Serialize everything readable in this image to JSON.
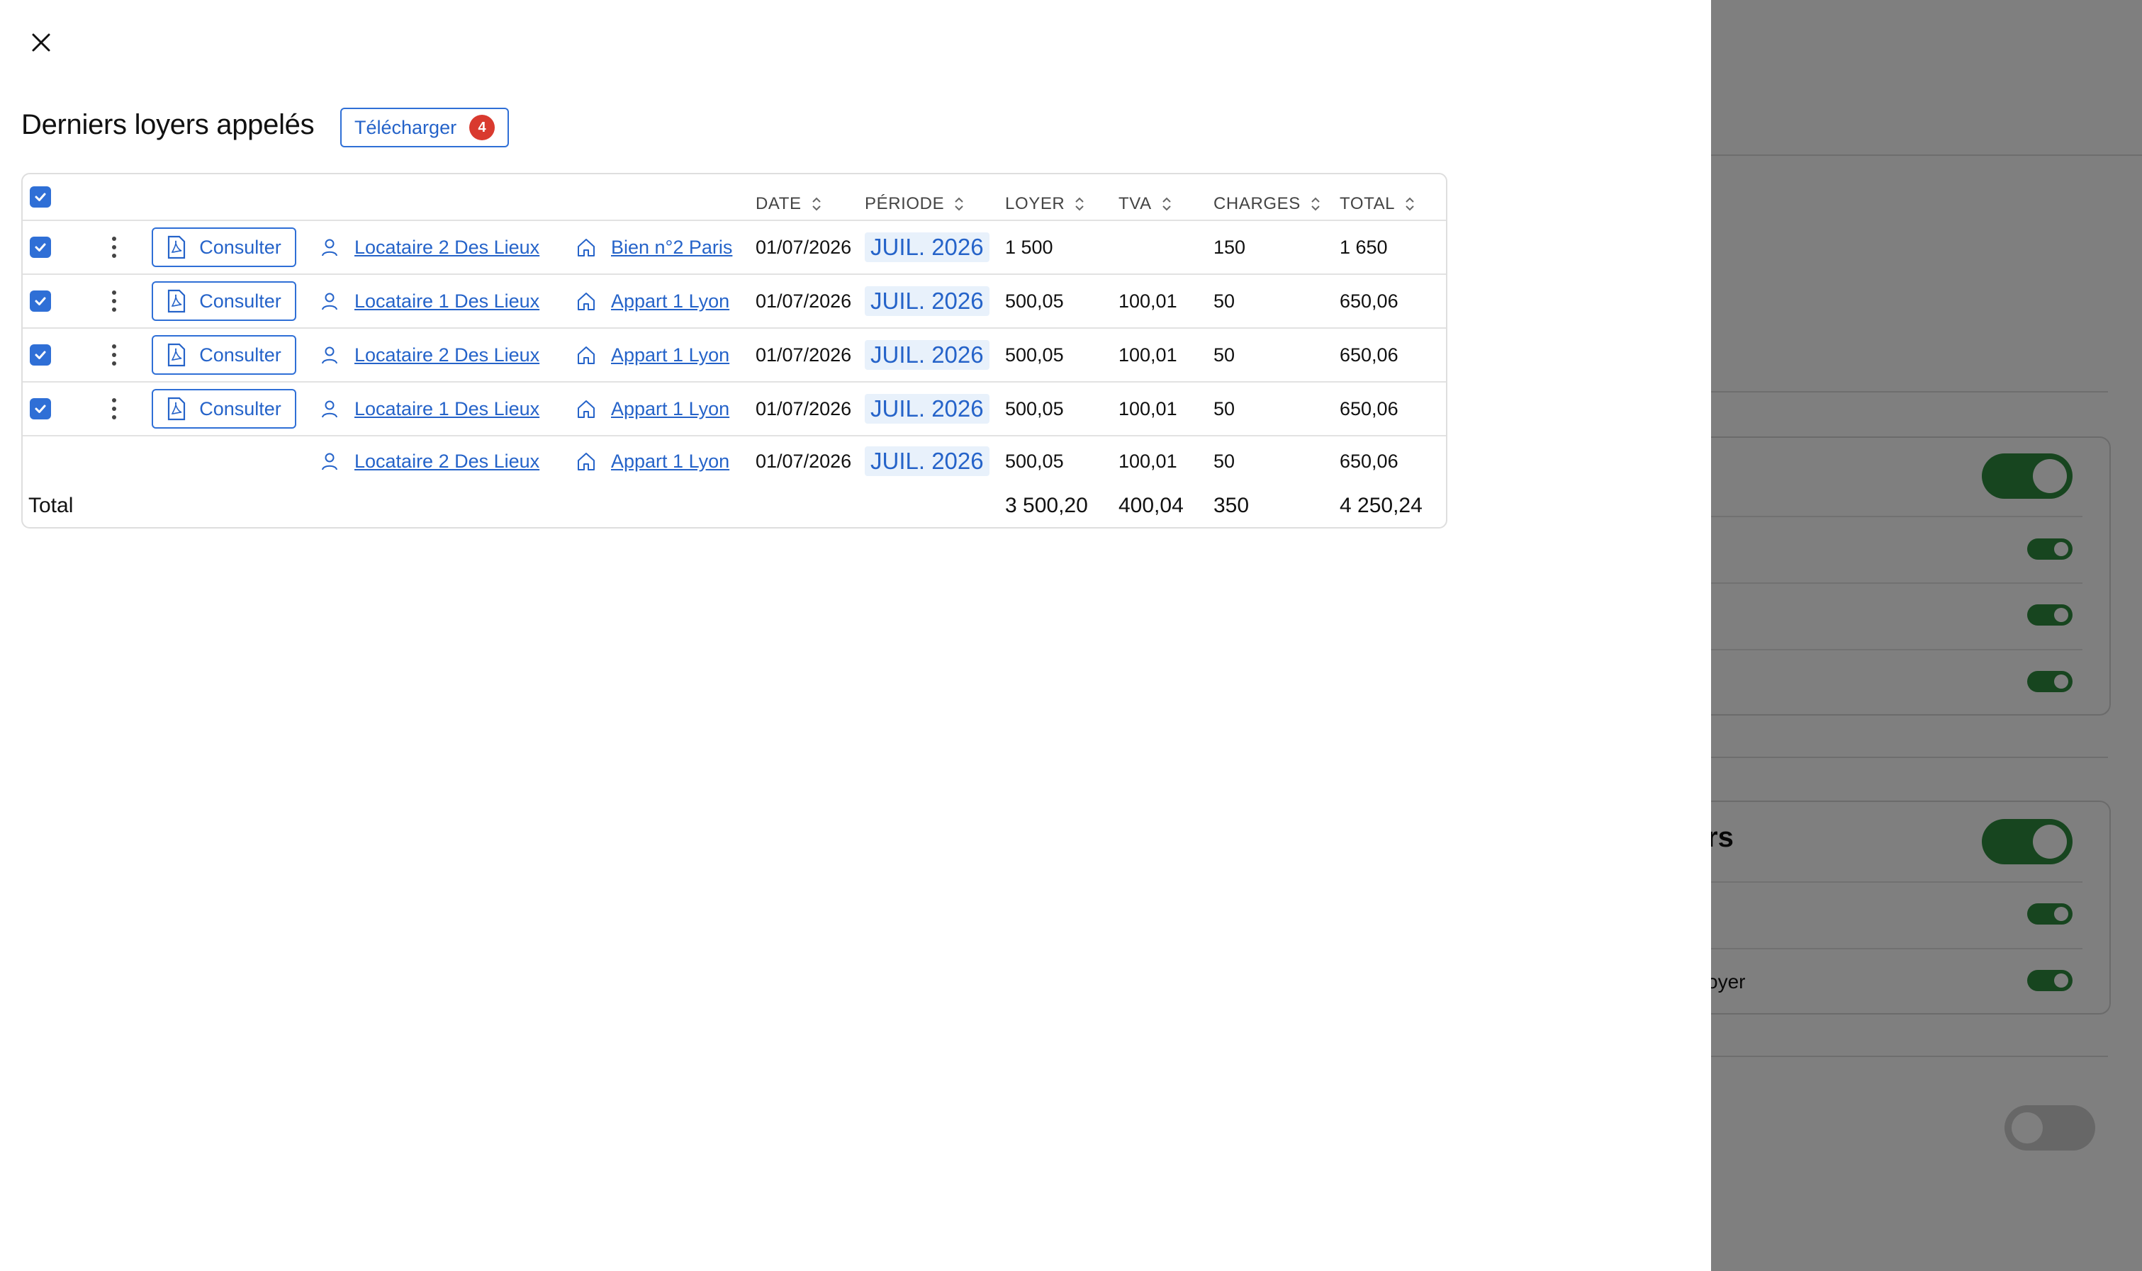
{
  "drawer": {
    "title": "Derniers loyers appelés",
    "download_label": "Télécharger",
    "download_count": "4"
  },
  "table": {
    "headers": {
      "date": "DATE",
      "period": "PÉRIODE",
      "rent": "LOYER",
      "vat": "TVA",
      "charges": "CHARGES",
      "total": "TOTAL"
    },
    "rows": [
      {
        "checked": true,
        "consult": "Consulter",
        "tenant": "Locataire 2 Des Lieux",
        "property": "Bien n°2 Paris",
        "date": "01/07/2026",
        "period": "JUIL. 2026",
        "rent": "1 500",
        "vat": "",
        "charges": "150",
        "total": "1 650"
      },
      {
        "checked": true,
        "consult": "Consulter",
        "tenant": "Locataire 1 Des Lieux",
        "property": "Appart 1 Lyon",
        "date": "01/07/2026",
        "period": "JUIL. 2026",
        "rent": "500,05",
        "vat": "100,01",
        "charges": "50",
        "total": "650,06"
      },
      {
        "checked": true,
        "consult": "Consulter",
        "tenant": "Locataire 2 Des Lieux",
        "property": "Appart 1 Lyon",
        "date": "01/07/2026",
        "period": "JUIL. 2026",
        "rent": "500,05",
        "vat": "100,01",
        "charges": "50",
        "total": "650,06"
      },
      {
        "checked": true,
        "consult": "Consulter",
        "tenant": "Locataire 1 Des Lieux",
        "property": "Appart 1 Lyon",
        "date": "01/07/2026",
        "period": "JUIL. 2026",
        "rent": "500,05",
        "vat": "100,01",
        "charges": "50",
        "total": "650,06"
      },
      {
        "checked": false,
        "consult": "",
        "tenant": "Locataire 2 Des Lieux",
        "property": "Appart 1 Lyon",
        "date": "01/07/2026",
        "period": "JUIL. 2026",
        "rent": "500,05",
        "vat": "100,01",
        "charges": "50",
        "total": "650,06"
      }
    ],
    "totals": {
      "label": "Total",
      "rent": "3 500,20",
      "vat": "400,04",
      "charges": "350",
      "total": "4 250,24"
    }
  },
  "background": {
    "fragment_1": "rs",
    "fragment_2": "oyer"
  },
  "colors": {
    "accent": "#2f6fd6",
    "badge": "#d93a2f",
    "toggle_on": "#2e8b3e",
    "overlay": "rgba(0,0,0,0.5)"
  }
}
